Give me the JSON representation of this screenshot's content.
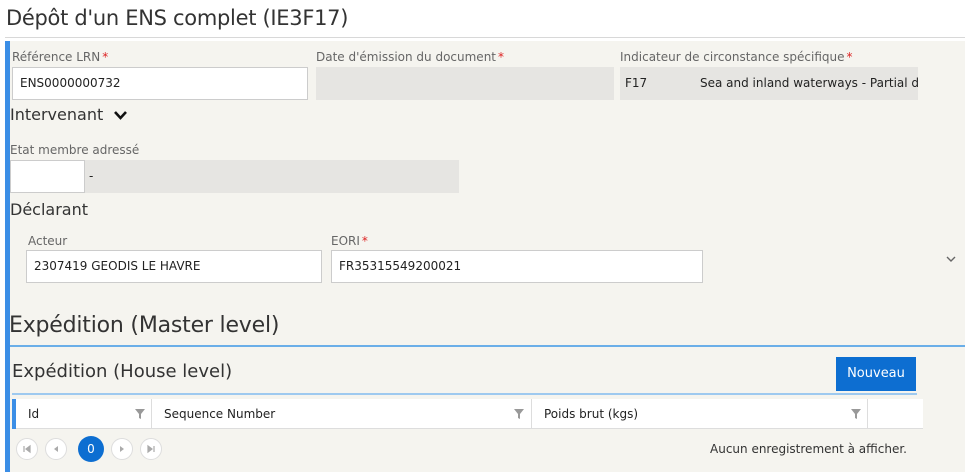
{
  "page": {
    "title": "Dépôt d'un ENS complet (IE3F17)"
  },
  "header_fields": {
    "lrn": {
      "label": "Référence LRN",
      "required": "*",
      "value": "ENS0000000732"
    },
    "date_emission": {
      "label": "Date d'émission du document",
      "required": "*",
      "value": ""
    },
    "indicateur": {
      "label": "Indicateur de circonstance spécifique",
      "required": "*",
      "code": "F17",
      "text": "Sea and inland waterways - Partial d..."
    }
  },
  "intervenant": {
    "heading": "Intervenant",
    "etat_membre": {
      "label": "Etat membre adressé",
      "code": "",
      "text": "-"
    }
  },
  "declarant": {
    "heading": "Déclarant",
    "acteur": {
      "label": "Acteur",
      "value": "2307419 GEODIS LE HAVRE"
    },
    "eori": {
      "label": "EORI",
      "required": "*",
      "value": "FR35315549200021"
    }
  },
  "master": {
    "heading": "Expédition (Master level)"
  },
  "house": {
    "heading": "Expédition (House level)",
    "new_button": "Nouveau",
    "columns": [
      "Id",
      "Sequence Number",
      "Poids brut (kgs)"
    ],
    "pager": {
      "current_page": "0",
      "info": "Aucun enregistrement à afficher."
    }
  },
  "icons": {
    "filter": "filter-icon",
    "chevron_down": "chevron-down-icon",
    "first": "first-page-icon",
    "prev": "prev-page-icon",
    "next": "next-page-icon",
    "last": "last-page-icon"
  },
  "colors": {
    "accent_blue": "#3b8ee6",
    "button_blue": "#0d6ed1",
    "required_red": "#dd2222",
    "panel_bg": "#f5f4ef",
    "readonly_bg": "#e6e5e2"
  }
}
